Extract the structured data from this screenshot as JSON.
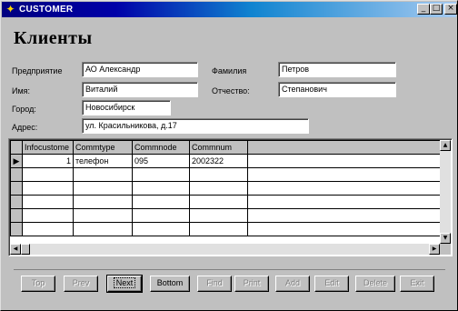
{
  "window": {
    "title": "CUSTOMER"
  },
  "form": {
    "heading": "Клиенты",
    "fields": {
      "company": {
        "label": "Предприятие",
        "value": "АО Александр"
      },
      "surname": {
        "label": "Фамилия",
        "value": "Петров"
      },
      "name": {
        "label": "Имя:",
        "value": "Виталий"
      },
      "patronymic": {
        "label": "Отчество:",
        "value": "Степанович"
      },
      "city": {
        "label": "Город:",
        "value": "Новосибирск"
      },
      "address": {
        "label": "Адрес:",
        "value": "ул. Красильникова, д.17"
      }
    }
  },
  "grid": {
    "columns": [
      "Infocustome",
      "Commtype",
      "Commnode",
      "Commnum"
    ],
    "rows": [
      {
        "infocustome": "1",
        "commtype": "телефон",
        "commnode": "095",
        "commnum": "2002322"
      }
    ]
  },
  "buttons": [
    {
      "label": "Top",
      "enabled": false
    },
    {
      "label": "Prev",
      "enabled": false
    },
    {
      "label": "Next",
      "enabled": true
    },
    {
      "label": "Bottom",
      "enabled": true
    },
    {
      "label": "Find",
      "enabled": false
    },
    {
      "label": "Print",
      "enabled": false
    },
    {
      "label": "Add",
      "enabled": false
    },
    {
      "label": "Edit",
      "enabled": false
    },
    {
      "label": "Delete",
      "enabled": false
    },
    {
      "label": "Exit",
      "enabled": false
    }
  ],
  "icons": {
    "app": "star-icon",
    "minimize": "minimize-icon",
    "maximize": "maximize-icon",
    "close": "close-icon",
    "row_indicator": "row-pointer-icon"
  }
}
